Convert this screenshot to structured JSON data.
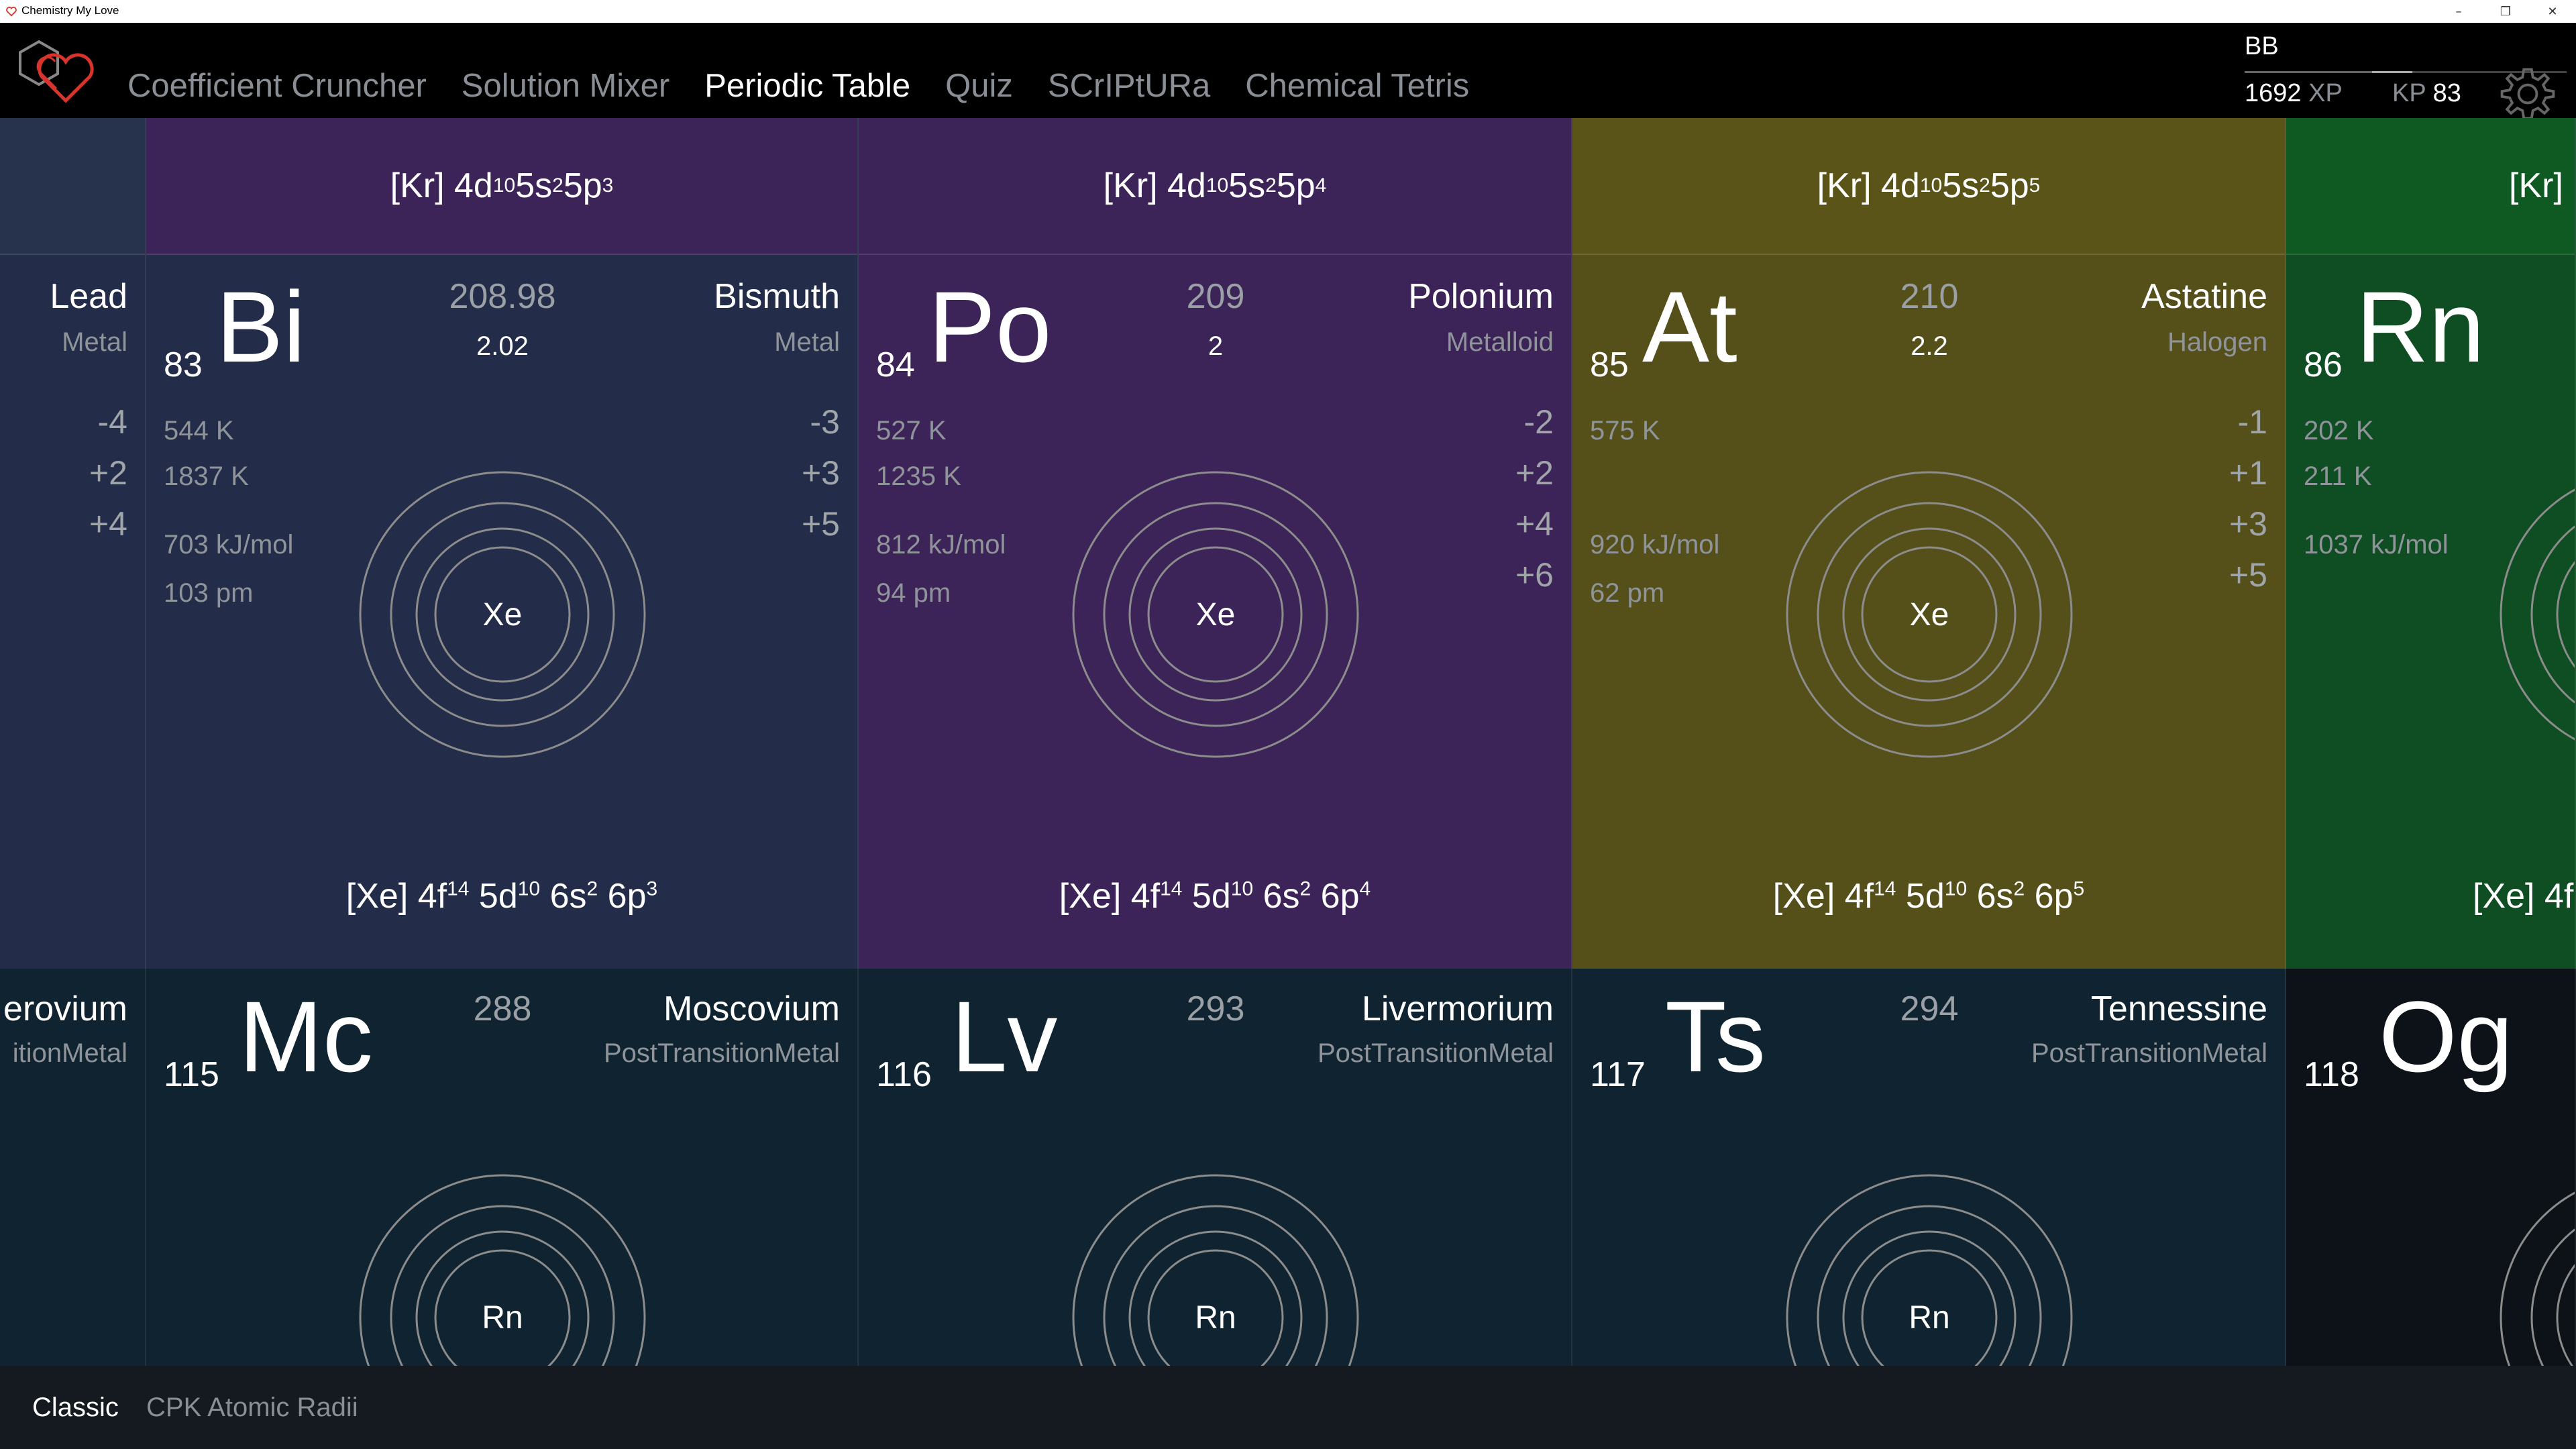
{
  "window": {
    "title": "Chemistry My Love"
  },
  "nav": {
    "items": [
      "Coefficient Cruncher",
      "Solution Mixer",
      "Periodic Table",
      "Quiz",
      "SCrIPtURa",
      "Chemical Tetris"
    ],
    "active": "Periodic Table"
  },
  "user": {
    "name": "BB",
    "xp": "1692",
    "xp_unit": "XP",
    "kp_unit": "KP",
    "kp": "83"
  },
  "colors": {
    "metal": "#232c48",
    "metalloid": "#3c2459",
    "halogen": "#55501a",
    "noble_gas": "#0f4d22",
    "post_transition": "#0f2430",
    "accent_red": "#d9342b"
  },
  "left_partial": {
    "name": "Lead",
    "category": "Metal",
    "oxidation": [
      "-4",
      "+2",
      "+4"
    ],
    "bottom_name": "erovium",
    "bottom_category": "itionMetal"
  },
  "row6": [
    {
      "header_core": "[Kr] 4d",
      "header_d": "10",
      "header_s_pre": " 5s",
      "header_s": "2",
      "header_p_pre": " 5p",
      "header_p": "3",
      "number": "83",
      "symbol": "Bi",
      "mass": "208.98",
      "electronegativity": "2.02",
      "name": "Bismuth",
      "category": "Metal",
      "melting": "544 K",
      "boiling": "1837 K",
      "ionization": "703 kJ/mol",
      "radius": "103 pm",
      "oxidation": [
        "-3",
        "+3",
        "+5"
      ],
      "core": "Xe",
      "footer_core": "[Xe] 4f",
      "footer_f": "14",
      "footer_d_pre": " 5d",
      "footer_d": "10",
      "footer_s_pre": " 6s",
      "footer_s": "2",
      "footer_p_pre": " 6p",
      "footer_p": "3"
    },
    {
      "header_core": "[Kr] 4d",
      "header_d": "10",
      "header_s_pre": " 5s",
      "header_s": "2",
      "header_p_pre": " 5p",
      "header_p": "4",
      "number": "84",
      "symbol": "Po",
      "mass": "209",
      "electronegativity": "2",
      "name": "Polonium",
      "category": "Metalloid",
      "melting": "527 K",
      "boiling": "1235 K",
      "ionization": "812 kJ/mol",
      "radius": "94 pm",
      "oxidation": [
        "-2",
        "+2",
        "+4",
        "+6"
      ],
      "core": "Xe",
      "footer_core": "[Xe] 4f",
      "footer_f": "14",
      "footer_d_pre": " 5d",
      "footer_d": "10",
      "footer_s_pre": " 6s",
      "footer_s": "2",
      "footer_p_pre": " 6p",
      "footer_p": "4"
    },
    {
      "header_core": "[Kr] 4d",
      "header_d": "10",
      "header_s_pre": " 5s",
      "header_s": "2",
      "header_p_pre": " 5p",
      "header_p": "5",
      "number": "85",
      "symbol": "At",
      "mass": "210",
      "electronegativity": "2.2",
      "name": "Astatine",
      "category": "Halogen",
      "melting": "575 K",
      "boiling": "",
      "ionization": "920 kJ/mol",
      "radius": "62 pm",
      "oxidation": [
        "-1",
        "+1",
        "+3",
        "+5"
      ],
      "core": "Xe",
      "footer_core": "[Xe] 4f",
      "footer_f": "14",
      "footer_d_pre": " 5d",
      "footer_d": "10",
      "footer_s_pre": " 6s",
      "footer_s": "2",
      "footer_p_pre": " 6p",
      "footer_p": "5"
    }
  ],
  "right_partial": {
    "header": "[Kr]",
    "number": "86",
    "symbol": "Rn",
    "melting": "202 K",
    "boiling": "211 K",
    "ionization": "1037 kJ/mol",
    "footer": "[Xe] 4f"
  },
  "row7": [
    {
      "number": "115",
      "symbol": "Mc",
      "mass": "288",
      "name": "Moscovium",
      "category": "PostTransitionMetal",
      "core": "Rn"
    },
    {
      "number": "116",
      "symbol": "Lv",
      "mass": "293",
      "name": "Livermorium",
      "category": "PostTransitionMetal",
      "core": "Rn"
    },
    {
      "number": "117",
      "symbol": "Ts",
      "mass": "294",
      "name": "Tennessine",
      "category": "PostTransitionMetal",
      "core": "Rn"
    }
  ],
  "row7_right": {
    "number": "118",
    "symbol": "Og"
  },
  "bottom_tabs": [
    "Classic",
    "CPK Atomic Radii"
  ],
  "bottom_active": "Classic"
}
